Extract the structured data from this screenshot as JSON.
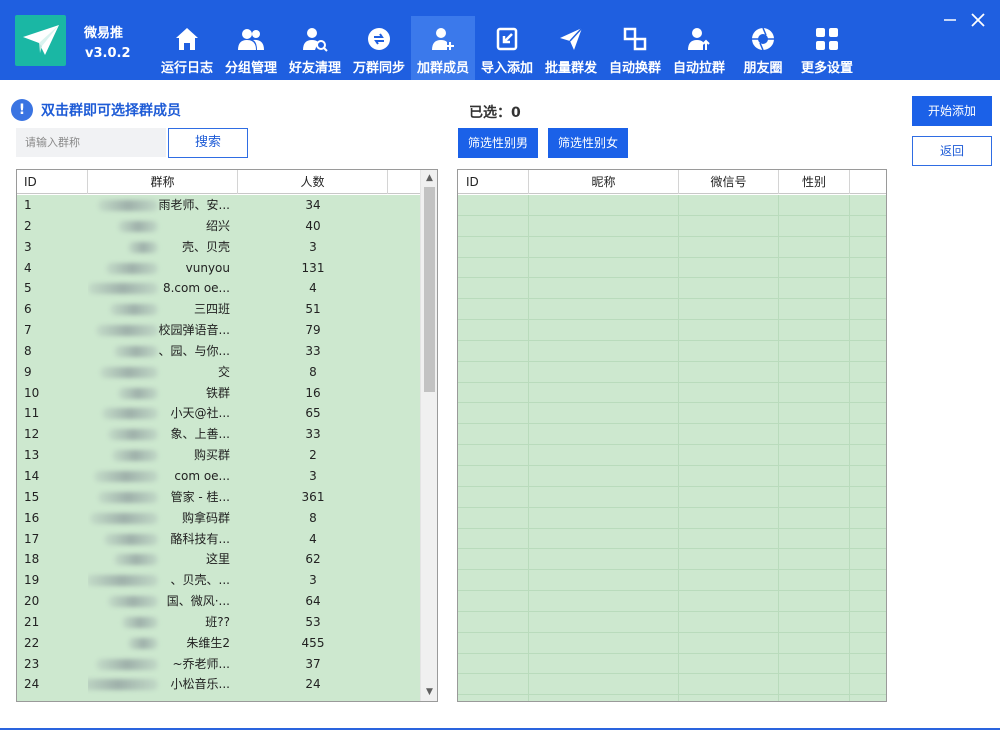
{
  "app": {
    "name": "微易推",
    "version": "v3.0.2"
  },
  "nav": [
    {
      "label": "运行日志",
      "icon": "home-icon"
    },
    {
      "label": "分组管理",
      "icon": "users-icon"
    },
    {
      "label": "好友清理",
      "icon": "user-search-icon"
    },
    {
      "label": "万群同步",
      "icon": "sync-icon"
    },
    {
      "label": "加群成员",
      "icon": "user-add-icon",
      "active": true
    },
    {
      "label": "导入添加",
      "icon": "import-icon"
    },
    {
      "label": "批量群发",
      "icon": "send-icon"
    },
    {
      "label": "自动换群",
      "icon": "swap-icon"
    },
    {
      "label": "自动拉群",
      "icon": "user-up-icon"
    },
    {
      "label": "朋友圈",
      "icon": "aperture-icon"
    },
    {
      "label": "更多设置",
      "icon": "grid-icon"
    }
  ],
  "left": {
    "hint": "双击群即可选择群成员",
    "search_placeholder": "请输入群称",
    "search_label": "搜索",
    "columns": {
      "id": "ID",
      "name": "群称",
      "count": "人数"
    },
    "rows": [
      {
        "id": "1",
        "name": "雨老师、安...",
        "count": "34"
      },
      {
        "id": "2",
        "name": "绍兴",
        "count": "40"
      },
      {
        "id": "3",
        "name": "壳、贝壳",
        "count": "3"
      },
      {
        "id": "4",
        "name": "vunyou",
        "count": "131"
      },
      {
        "id": "5",
        "name": "8.com oe...",
        "count": "4"
      },
      {
        "id": "6",
        "name": "三四班",
        "count": "51"
      },
      {
        "id": "7",
        "name": "校园弹语音...",
        "count": "79"
      },
      {
        "id": "8",
        "name": "、园、与你...",
        "count": "33"
      },
      {
        "id": "9",
        "name": "交",
        "count": "8"
      },
      {
        "id": "10",
        "name": "铁群",
        "count": "16"
      },
      {
        "id": "11",
        "name": "小天@社...",
        "count": "65"
      },
      {
        "id": "12",
        "name": "象、上善...",
        "count": "33"
      },
      {
        "id": "13",
        "name": "购买群",
        "count": "2"
      },
      {
        "id": "14",
        "name": "com oe...",
        "count": "3"
      },
      {
        "id": "15",
        "name": "管家 - 桂...",
        "count": "361"
      },
      {
        "id": "16",
        "name": "购拿码群",
        "count": "8"
      },
      {
        "id": "17",
        "name": "酪科技有...",
        "count": "4"
      },
      {
        "id": "18",
        "name": "这里",
        "count": "62"
      },
      {
        "id": "19",
        "name": "、贝壳、...",
        "count": "3"
      },
      {
        "id": "20",
        "name": "国、微风·...",
        "count": "64"
      },
      {
        "id": "21",
        "name": "班??",
        "count": "53"
      },
      {
        "id": "22",
        "name": "朱维生2",
        "count": "455"
      },
      {
        "id": "23",
        "name": "~乔老师...",
        "count": "37"
      },
      {
        "id": "24",
        "name": "小松音乐...",
        "count": "24"
      }
    ]
  },
  "right": {
    "selected_label": "已选：",
    "selected_count": "0",
    "filter_male": "筛选性别男",
    "filter_female": "筛选性别女",
    "columns": {
      "id": "ID",
      "nickname": "昵称",
      "wechat": "微信号",
      "gender": "性别"
    }
  },
  "actions": {
    "start": "开始添加",
    "back": "返回"
  },
  "colors": {
    "header": "#1f5fe0",
    "active_tab": "#3b79eb",
    "row_bg": "#cde8cf",
    "accent": "#1b61e8"
  }
}
